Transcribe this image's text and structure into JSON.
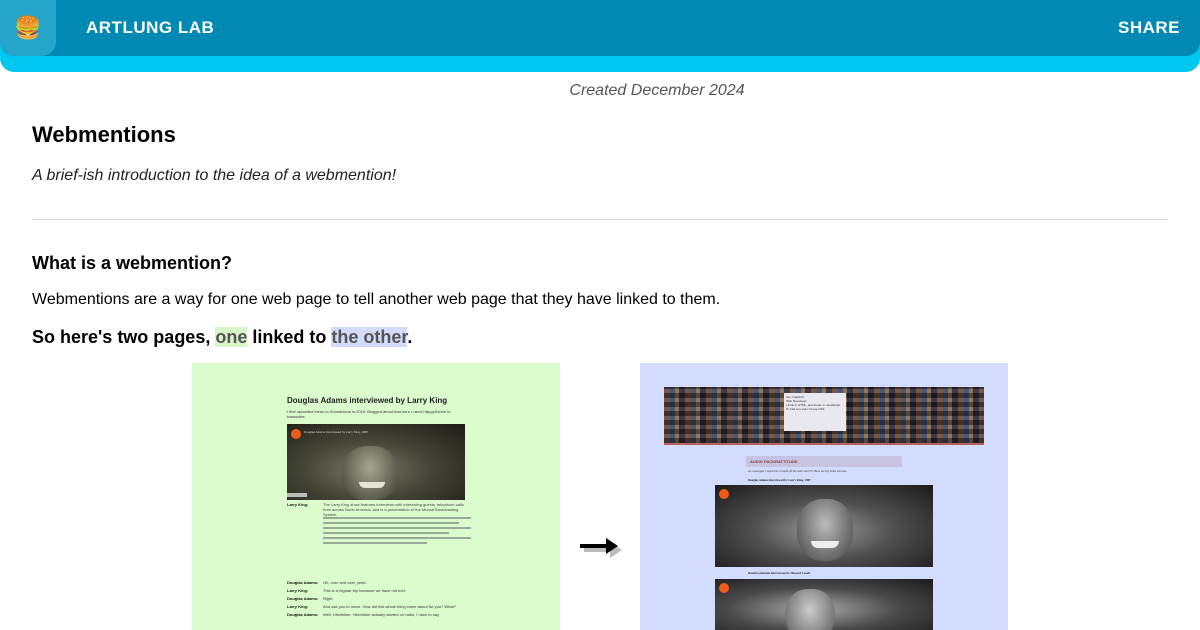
{
  "header": {
    "logo_emoji": "🍔",
    "brand": "ARTLUNG LAB",
    "share_label": "SHARE",
    "colors": {
      "header_dark": "#0089b2",
      "header_light": "#00c6f2"
    }
  },
  "article": {
    "created": "Created December 2024",
    "title": "Webmentions",
    "subtitle": "A brief-ish introduction to the idea of a webmention!",
    "section_heading": "What is a webmention?",
    "paragraph": "Webmentions are a way for one web page to tell another web page that they have linked to them.",
    "pages_heading": {
      "before": "So here's two pages, ",
      "one": "one",
      "middle": " linked to ",
      "other": "the other",
      "after": "."
    }
  },
  "left_page": {
    "title": "Douglas Adams interviewed by Larry King",
    "intro": "I first uploaded these to Soundcloud in 2016. Blogged about that here I used HappyScribe to transcribe.",
    "player_caption": "Douglas Adams Interviewed by Larry King, 1987",
    "rows": [
      {
        "speaker": "Larry King:",
        "text": "The Larry King show features interviews with interesting guests, telephone calls from across North America, and is a presentation of the Mutual Broadcasting System."
      },
      {
        "speaker": "Douglas Adams:",
        "text": "Oh, over and over, yeah."
      },
      {
        "speaker": "Larry King:",
        "text": "This is a regular trip because we have not met."
      },
      {
        "speaker": "Douglas Adams:",
        "text": "Right."
      },
      {
        "speaker": "Larry King:",
        "text": "And ask you to move. How did this whole thing come about for you? What?"
      },
      {
        "speaker": "Douglas Adams:",
        "text": "Well, Hitchhiker. Hitchhiker actually started on radio, I have to say."
      }
    ]
  },
  "right_page": {
    "card_lines": [
      "Joe Crawford",
      "Web Developer",
      "I think in HTML, and dream in JavaScript",
      "If I had any style I'd use CSS"
    ],
    "heading": "AUDIO PACKRATTITUDE",
    "note": "As a teenager I taped lots of stuff off the radio and TV. Here are my latest encodes",
    "sub_1": "Douglas Adams interviewed by Larry King, 1987",
    "sub_2": "David Letterman interviewed by Howard Cosell"
  },
  "arrow_icon": "right-arrow-icon"
}
